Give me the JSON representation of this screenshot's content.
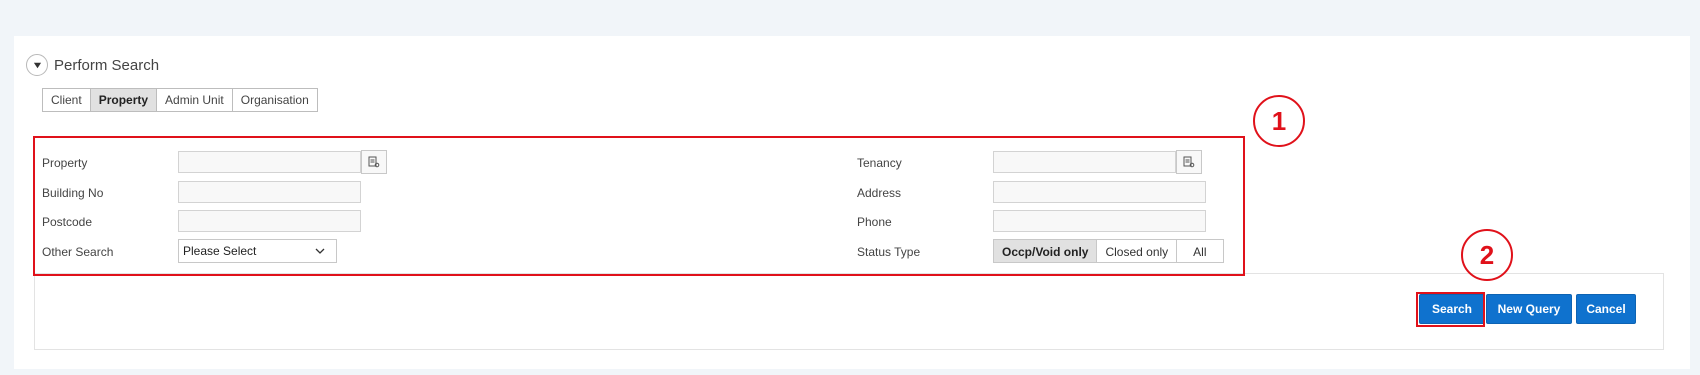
{
  "section": {
    "title": "Perform Search",
    "toggle_icon": "triangle-down-icon"
  },
  "tabs": [
    {
      "label": "Client",
      "active": false
    },
    {
      "label": "Property",
      "active": true
    },
    {
      "label": "Admin Unit",
      "active": false
    },
    {
      "label": "Organisation",
      "active": false
    }
  ],
  "form": {
    "left": {
      "property_label": "Property",
      "property_value": "",
      "building_no_label": "Building No",
      "building_no_value": "",
      "postcode_label": "Postcode",
      "postcode_value": "",
      "other_search_label": "Other Search",
      "other_search_value": "Please Select"
    },
    "right": {
      "tenancy_label": "Tenancy",
      "tenancy_value": "",
      "address_label": "Address",
      "address_value": "",
      "phone_label": "Phone",
      "phone_value": "",
      "status_type_label": "Status Type",
      "status_options": [
        {
          "label": "Occp/Void only",
          "active": true
        },
        {
          "label": "Closed only",
          "active": false
        },
        {
          "label": "All",
          "active": false
        }
      ]
    }
  },
  "actions": {
    "search": "Search",
    "new_query": "New Query",
    "cancel": "Cancel"
  },
  "annotations": {
    "callout_1": "1",
    "callout_2": "2",
    "highlight_color": "#e0111a"
  },
  "colors": {
    "primary_button": "#0f72ce",
    "background": "#f1f5f9"
  }
}
